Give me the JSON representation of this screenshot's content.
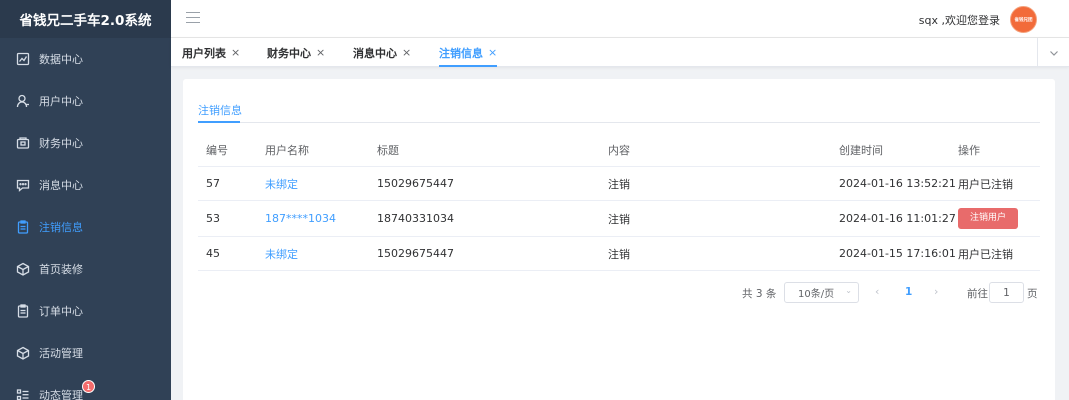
{
  "app": {
    "title": "省钱兄二手车2.0系统"
  },
  "sidebar": {
    "items": [
      {
        "label": "数据中心",
        "icon": "chart-icon"
      },
      {
        "label": "用户中心",
        "icon": "user-icon"
      },
      {
        "label": "财务中心",
        "icon": "wallet-icon"
      },
      {
        "label": "消息中心",
        "icon": "message-icon"
      },
      {
        "label": "注销信息",
        "icon": "clipboard-icon",
        "active": true
      },
      {
        "label": "首页装修",
        "icon": "cube-icon"
      },
      {
        "label": "订单中心",
        "icon": "clipboard-icon"
      },
      {
        "label": "活动管理",
        "icon": "cube-icon"
      },
      {
        "label": "动态管理",
        "icon": "list-icon",
        "badge": "1"
      }
    ]
  },
  "header": {
    "welcome": "sqx ,欢迎您登录",
    "avatar_text": "省钱兄团"
  },
  "tabs": [
    {
      "label": "用户列表",
      "close": "×"
    },
    {
      "label": "财务中心",
      "close": "×"
    },
    {
      "label": "消息中心",
      "close": "×"
    },
    {
      "label": "注销信息",
      "close": "×",
      "active": true
    }
  ],
  "main": {
    "inner_tab": "注销信息",
    "table": {
      "headers": [
        "编号",
        "用户名称",
        "标题",
        "内容",
        "创建时间",
        "操作"
      ],
      "rows": [
        {
          "id": "57",
          "user": "未绑定",
          "title": "15029675447",
          "content": "注销",
          "created": "2024-01-16 13:52:21",
          "action": "用户已注销",
          "action_type": "text"
        },
        {
          "id": "53",
          "user": "187****1034",
          "title": "18740331034",
          "content": "注销",
          "created": "2024-01-16 11:01:27",
          "action": "注销用户",
          "action_type": "button"
        },
        {
          "id": "45",
          "user": "未绑定",
          "title": "15029675447",
          "content": "注销",
          "created": "2024-01-15 17:16:01",
          "action": "用户已注销",
          "action_type": "text"
        }
      ]
    },
    "pagination": {
      "total": "共 3 条",
      "page_size": "10条/页",
      "current_page": "1",
      "goto_label": "前往",
      "goto_value": "1",
      "page_suffix": "页"
    }
  },
  "colors": {
    "sidebar_bg": "#304156",
    "accent": "#409eff",
    "danger": "#e86b6b",
    "avatar": "#f26b3a"
  }
}
